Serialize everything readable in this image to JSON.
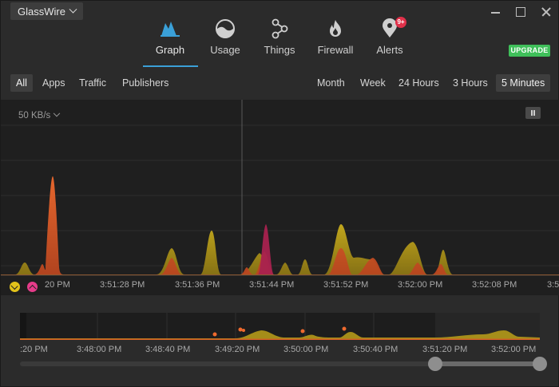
{
  "app": {
    "menu_label": "GlassWire"
  },
  "nav": {
    "items": [
      {
        "label": "Graph",
        "icon": "graph-icon",
        "active": true
      },
      {
        "label": "Usage",
        "icon": "usage-icon"
      },
      {
        "label": "Things",
        "icon": "things-icon"
      },
      {
        "label": "Firewall",
        "icon": "firewall-icon"
      },
      {
        "label": "Alerts",
        "icon": "alerts-icon",
        "badge": "9+"
      }
    ],
    "upgrade_label": "UPGRADE"
  },
  "filters": {
    "left": [
      "All",
      "Apps",
      "Traffic",
      "Publishers"
    ],
    "right": [
      "Month",
      "Week",
      "24 Hours",
      "3 Hours",
      "5 Minutes"
    ],
    "active_left": "All",
    "active_right": "5 Minutes"
  },
  "graph": {
    "scale_label": "50 KB/s",
    "x_ticks": [
      "20 PM",
      "3:51:28 PM",
      "3:51:36 PM",
      "3:51:44 PM",
      "3:51:52 PM",
      "3:52:00 PM",
      "3:52:08 PM",
      "3:5"
    ]
  },
  "overview": {
    "x_ticks": [
      ":20 PM",
      "3:48:00 PM",
      "3:48:40 PM",
      "3:49:20 PM",
      "3:50:00 PM",
      "3:50:40 PM",
      "3:51:20 PM",
      "3:52:00 PM"
    ]
  },
  "colors": {
    "incoming": "#d4b21d",
    "outgoing": "#e8632c",
    "spike": "#b8255a",
    "accent": "#3aa0d8",
    "upgrade": "#3fbf5a"
  }
}
